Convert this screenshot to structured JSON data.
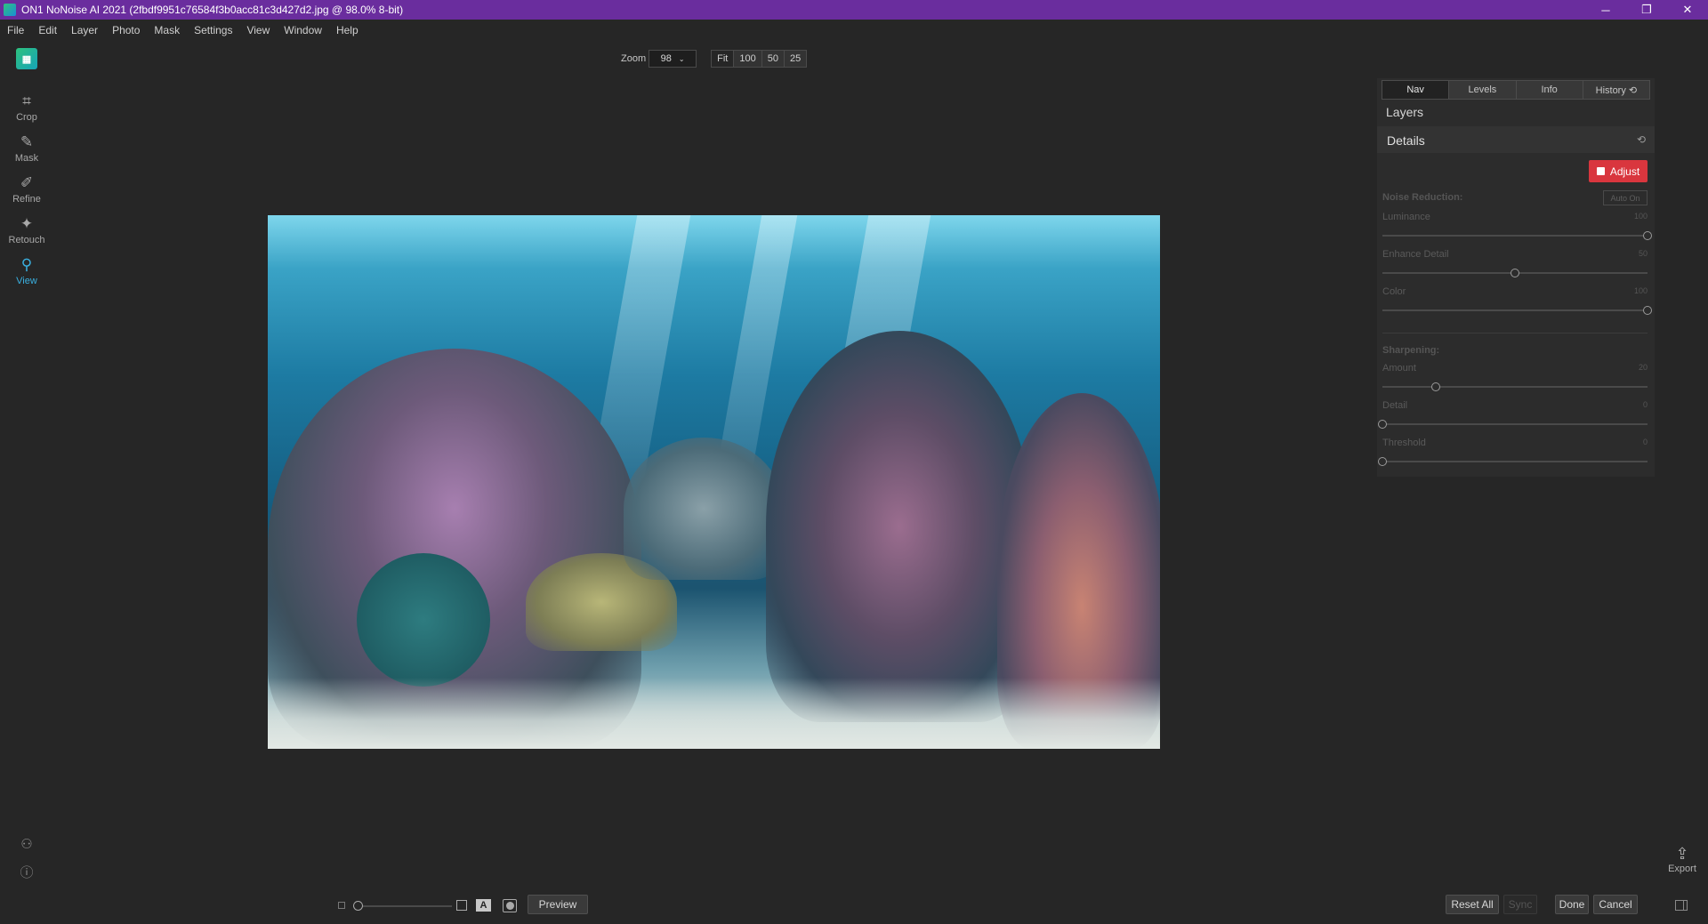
{
  "window": {
    "title": "ON1 NoNoise AI 2021 (2fbdf9951c76584f3b0acc81c3d427d2.jpg @ 98.0% 8-bit)",
    "minimize": "─",
    "restore": "❐",
    "close": "✕"
  },
  "menu": [
    "File",
    "Edit",
    "Layer",
    "Photo",
    "Mask",
    "Settings",
    "View",
    "Window",
    "Help"
  ],
  "tools": [
    {
      "label": "Crop",
      "icon": "crop-icon",
      "glyph": "⌗"
    },
    {
      "label": "Mask",
      "icon": "mask-brush-icon",
      "glyph": "✎"
    },
    {
      "label": "Refine",
      "icon": "refine-brush-icon",
      "glyph": "✐"
    },
    {
      "label": "Retouch",
      "icon": "retouch-icon",
      "glyph": "✦"
    },
    {
      "label": "View",
      "icon": "view-zoom-icon",
      "glyph": "⚲",
      "active": true
    }
  ],
  "zoom": {
    "label": "Zoom",
    "value": "98",
    "presets": [
      "Fit",
      "100",
      "50",
      "25"
    ]
  },
  "panel": {
    "tabs": [
      "Nav",
      "Levels",
      "Info",
      "History ⟲"
    ],
    "active_tab": "Nav",
    "layers_title": "Layers",
    "details_title": "Details",
    "adjust_label": "Adjust",
    "noise_reduction": {
      "heading": "Noise Reduction:",
      "auto_on": "Auto On",
      "sliders": [
        {
          "label": "Luminance",
          "value": 100
        },
        {
          "label": "Enhance Detail",
          "value": 50
        },
        {
          "label": "Color",
          "value": 100
        }
      ]
    },
    "sharpening": {
      "heading": "Sharpening:",
      "sliders": [
        {
          "label": "Amount",
          "value": 20
        },
        {
          "label": "Detail",
          "value": 0
        },
        {
          "label": "Threshold",
          "value": 0
        }
      ]
    }
  },
  "bottom": {
    "preview": "Preview",
    "reset_all": "Reset All",
    "sync": "Sync",
    "done": "Done",
    "cancel": "Cancel",
    "export": "Export"
  },
  "colors": {
    "titlebar": "#6a2d9e",
    "accent": "#3ab0e0",
    "adjust": "#d9363e"
  }
}
